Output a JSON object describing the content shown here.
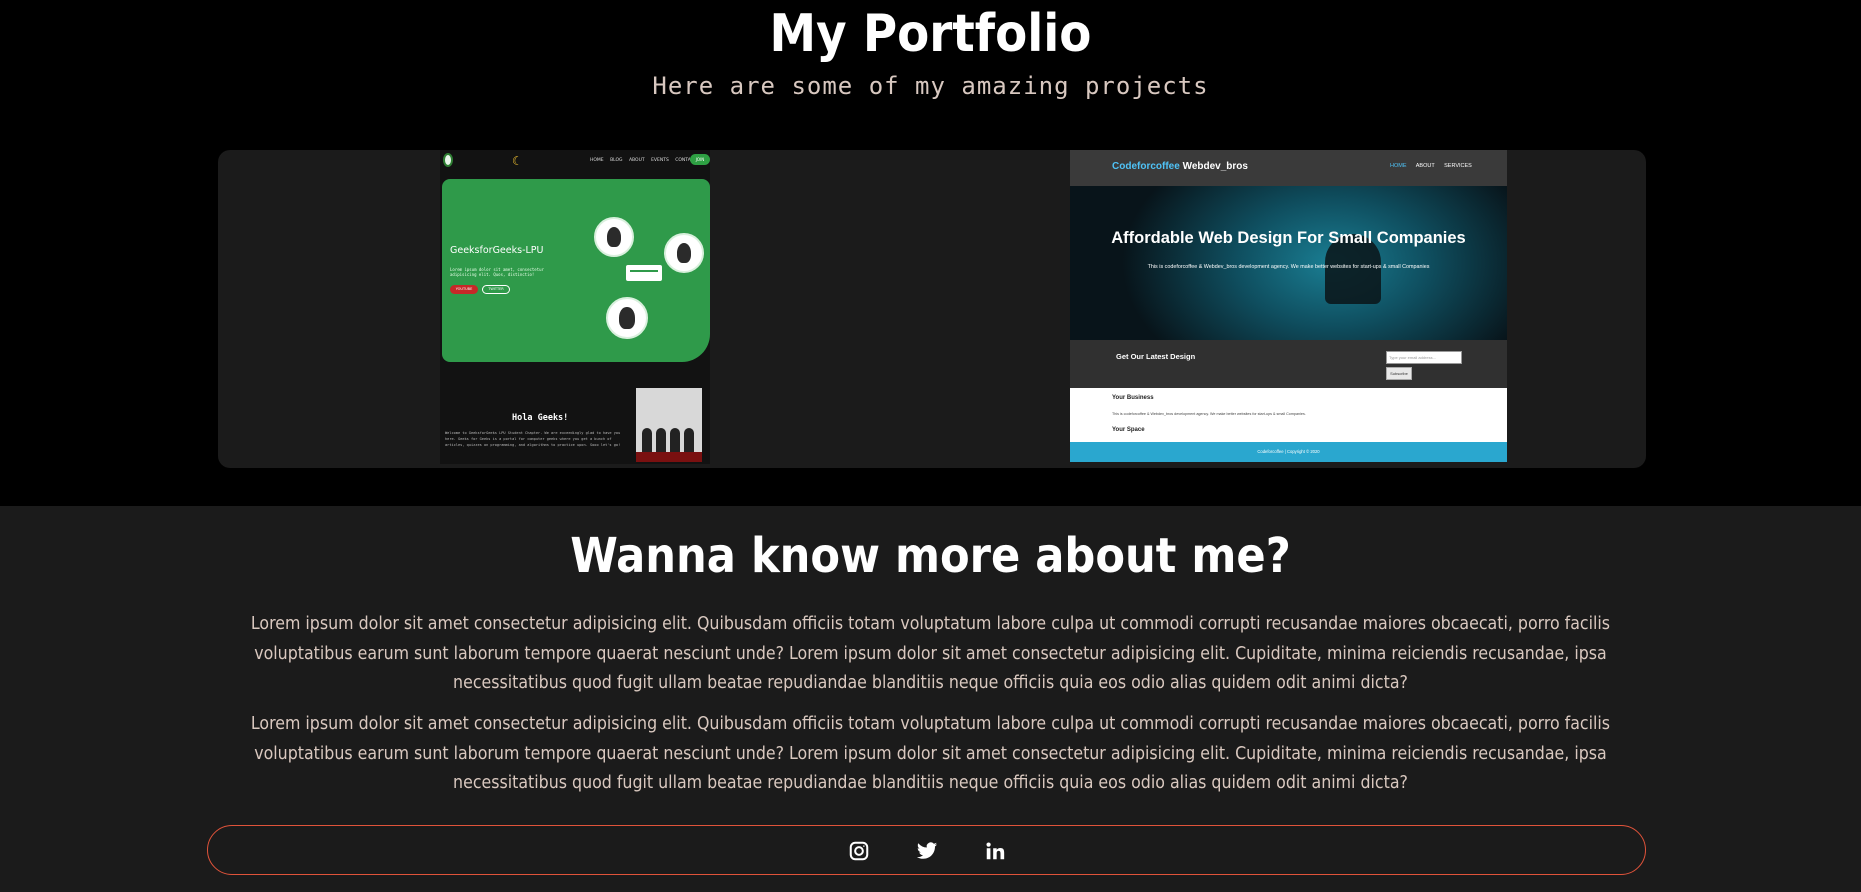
{
  "header": {
    "title": "My Portfolio",
    "subtitle": "Here are some of my amazing projects"
  },
  "projects": [
    {
      "site": "GeeksforGeeks-LPU",
      "nav_links": "HOME BLOG ABOUT EVENTS CONTACT",
      "join_label": "JOIN",
      "hero_text": "Lorem ipsum dolor sit amet, consectetur adipisicing elit. Quos, distinctio!",
      "button_primary": "YOUTUBE",
      "button_secondary": "TWITTER",
      "section_title": "Hola Geeks!",
      "section_text": "Welcome to GeeksforGeeks LPU Student Chapter. We are exceedingly glad to have you here. Geeks for Geeks is a portal for computer geeks where you get a bunch of articles, quizzes on programming, and algorithms to practice upon. Sooo let's go!"
    },
    {
      "brand_accent": "Codeforcoffee",
      "brand_rest": "Webdev_bros",
      "menu": [
        "HOME",
        "ABOUT",
        "SERVICES"
      ],
      "hero_title": "Affordable Web Design For Small Companies",
      "hero_sub": "This is codeforcoffee & Webdev_bros development agency. We make better websites for start-ups & small Companies",
      "subscribe_title": "Get Our Latest Design",
      "email_placeholder": "Type your email address...",
      "subscribe_label": "Subscribe",
      "business_title": "Your Business",
      "business_text": "This is codeforcoffee & Webdev_bros development agency. We make better websites for start-ups & small Companies.",
      "space_title": "Your Space",
      "footer": "Codeforcoffee | Copyright © 2020"
    }
  ],
  "about": {
    "title": "Wanna know more about me?",
    "paragraphs": [
      "Lorem ipsum dolor sit amet consectetur adipisicing elit. Quibusdam officiis totam voluptatum labore culpa ut commodi corrupti recusandae maiores obcaecati, porro facilis voluptatibus earum sunt laborum tempore quaerat nesciunt unde? Lorem ipsum dolor sit amet consectetur adipisicing elit. Cupiditate, minima reiciendis recusandae, ipsa necessitatibus quod fugit ullam beatae repudiandae blanditiis neque officiis quia eos odio alias quidem odit animi dicta?",
      "Lorem ipsum dolor sit amet consectetur adipisicing elit. Quibusdam officiis totam voluptatum labore culpa ut commodi corrupti recusandae maiores obcaecati, porro facilis voluptatibus earum sunt laborum tempore quaerat nesciunt unde? Lorem ipsum dolor sit amet consectetur adipisicing elit. Cupiditate, minima reiciendis recusandae, ipsa necessitatibus quod fugit ullam beatae repudiandae blanditiis neque officiis quia eos odio alias quidem odit animi dicta?"
    ]
  },
  "social": {
    "icons": [
      "instagram-icon",
      "twitter-icon",
      "linkedin-icon"
    ],
    "border_color": "#e0533a"
  },
  "colors": {
    "background": "#000000",
    "section_background": "#1b1b1b",
    "text_muted": "#d9c8bf",
    "gfg_green": "#2f9a4a",
    "accent_blue": "#4fc3f7"
  }
}
